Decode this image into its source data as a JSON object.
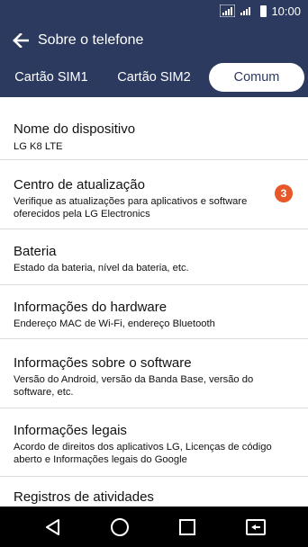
{
  "status": {
    "time": "10:00",
    "network_1": "3G",
    "network_2": "3G",
    "icons": [
      "signal-icon",
      "signal-icon",
      "battery-icon"
    ]
  },
  "header": {
    "title": "Sobre o telefone",
    "back_icon": "arrow-left-icon"
  },
  "tabs": [
    {
      "label": "Cartão SIM1",
      "active": false
    },
    {
      "label": "Cartão SIM2",
      "active": false
    },
    {
      "label": "Comum",
      "active": true
    }
  ],
  "items": [
    {
      "title": "Nome do dispositivo",
      "subtitle": "LG K8 LTE"
    },
    {
      "title": "Centro de atualização",
      "subtitle": "Verifique as atualizações para aplicativos e software oferecidos pela LG Electronics",
      "badge": "3"
    },
    {
      "title": "Bateria",
      "subtitle": "Estado da bateria, nível da bateria, etc."
    },
    {
      "title": "Informações do hardware",
      "subtitle": "Endereço MAC de Wi-Fi, endereço Bluetooth"
    },
    {
      "title": "Informações sobre o software",
      "subtitle": "Versão do Android, versão da Banda Base, versão do software, etc."
    },
    {
      "title": "Informações legais",
      "subtitle": "Acordo de direitos dos aplicativos LG, Licenças de código aberto e Informações legais do Google"
    },
    {
      "title": "Registros de atividades",
      "subtitle": ""
    }
  ],
  "nav": {
    "icons": [
      "back-triangle-icon",
      "home-circle-icon",
      "recents-square-icon",
      "dual-window-icon"
    ]
  },
  "colors": {
    "header_bg": "#2d3a5f",
    "badge": "#e8572a",
    "nav_bg": "#000000"
  }
}
